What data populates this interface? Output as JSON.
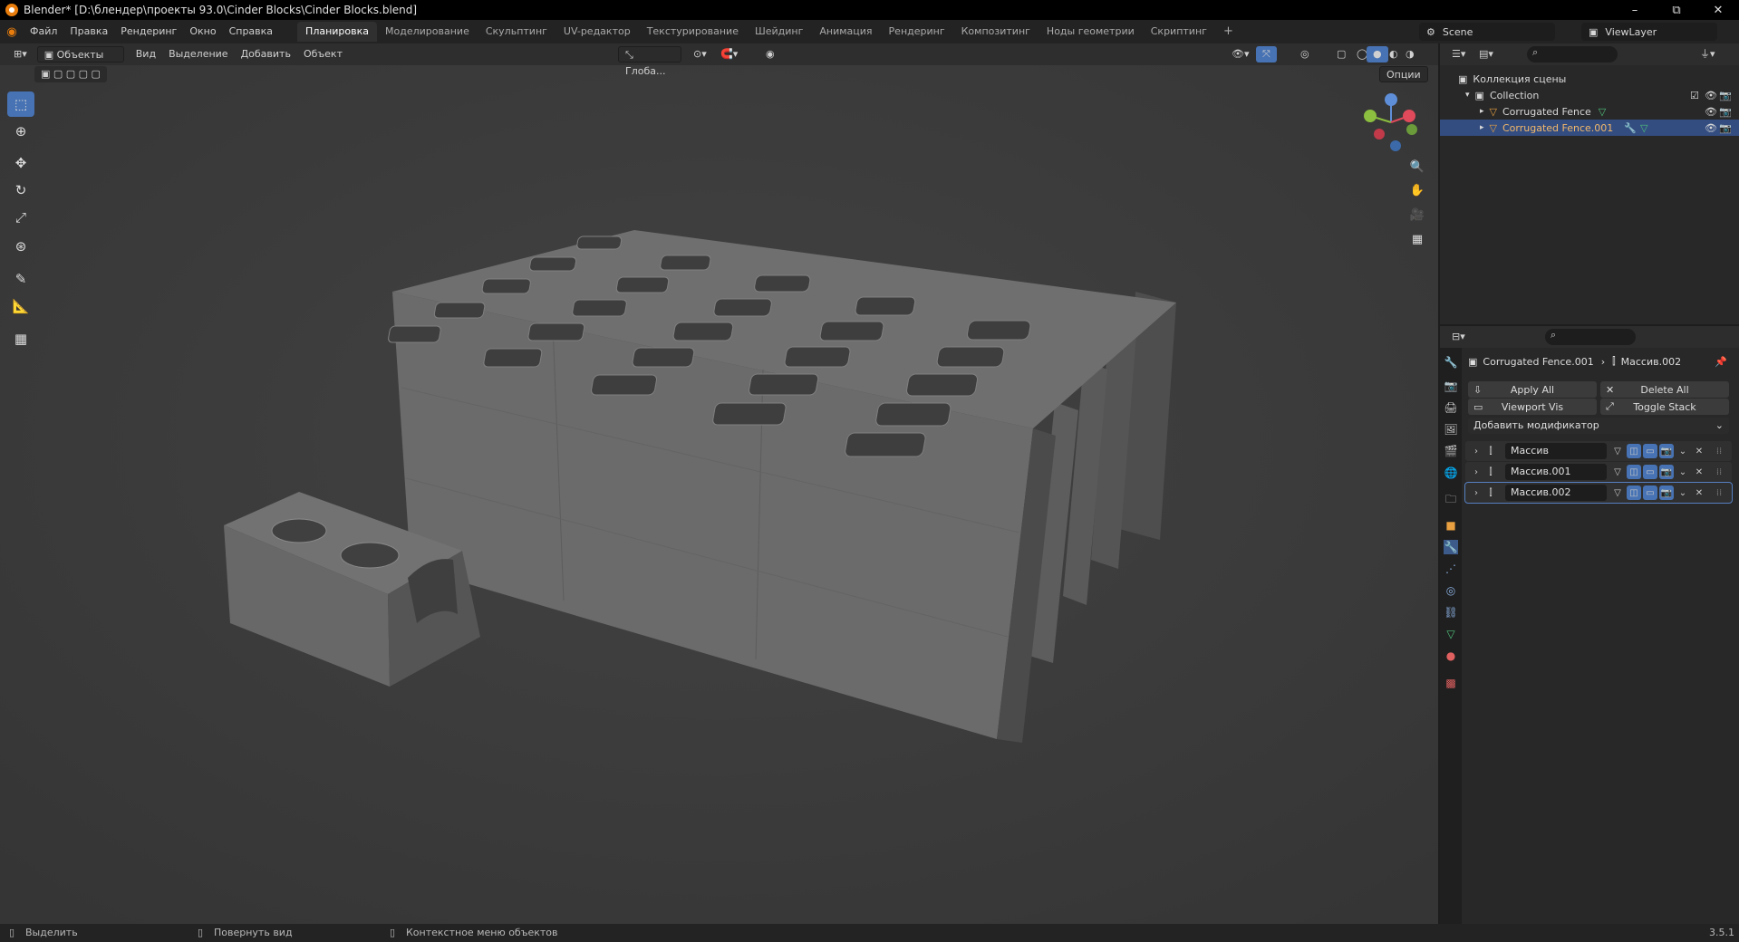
{
  "window": {
    "title": "Blender* [D:\\блендер\\проекты 93.0\\Cinder Blocks\\Cinder Blocks.blend]",
    "minimize": "–",
    "maximize": "⧉",
    "close": "✕"
  },
  "menubar": {
    "items": [
      "Файл",
      "Правка",
      "Рендеринг",
      "Окно",
      "Справка"
    ],
    "workspaces": [
      "Планировка",
      "Моделирование",
      "Скульптинг",
      "UV-редактор",
      "Текстурирование",
      "Шейдинг",
      "Анимация",
      "Рендеринг",
      "Композитинг",
      "Ноды геометрии",
      "Скриптинг"
    ],
    "active_workspace": "Планировка",
    "add_tab": "+",
    "scene": "Scene",
    "view_layer": "ViewLayer"
  },
  "viewport_header": {
    "mode": "Объекты",
    "menus": [
      "Вид",
      "Выделение",
      "Добавить",
      "Объект"
    ],
    "orientation": "Глоба...",
    "options": "Опции"
  },
  "outliner": {
    "root": "Коллекция сцены",
    "collection": "Collection",
    "objects": [
      {
        "name": "Corrugated Fence",
        "selected": false
      },
      {
        "name": "Corrugated Fence.001",
        "selected": true
      }
    ]
  },
  "properties": {
    "breadcrumb_object": "Corrugated Fence.001",
    "breadcrumb_modifier": "Массив.002",
    "apply_all": "Apply All",
    "delete_all": "Delete All",
    "viewport_vis": "Viewport Vis",
    "toggle_stack": "Toggle Stack",
    "add_modifier": "Добавить модификатор",
    "modifiers": [
      {
        "name": "Массив",
        "active": false
      },
      {
        "name": "Массив.001",
        "active": false
      },
      {
        "name": "Массив.002",
        "active": true
      }
    ]
  },
  "statusbar": {
    "select": "Выделить",
    "rotate_view": "Повернуть вид",
    "context_menu": "Контекстное меню объектов",
    "version": "3.5.1"
  },
  "colors": {
    "accent": "#4772b3",
    "selected_row": "#334d80",
    "viewport_bg": "#3d3d3d",
    "panel_bg": "#282828"
  }
}
